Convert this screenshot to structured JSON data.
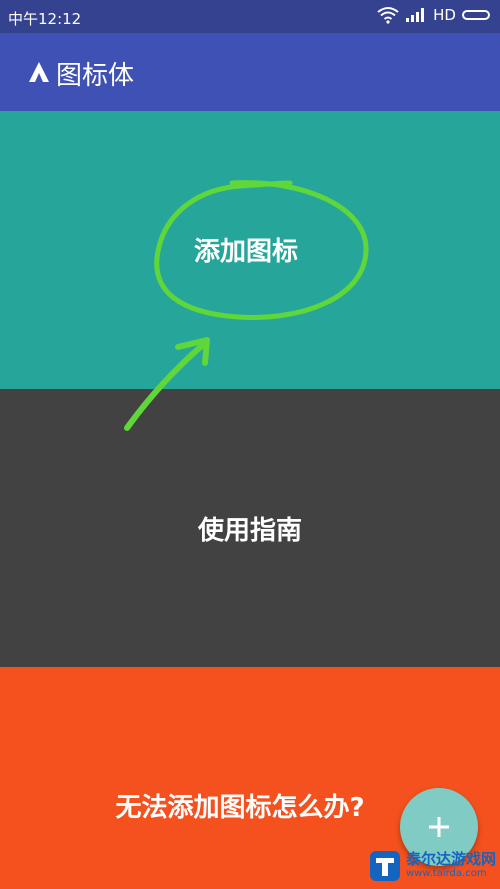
{
  "status_bar": {
    "time": "中午12:12",
    "network": "HD"
  },
  "app_bar": {
    "title": "图标体"
  },
  "panels": {
    "add_icon": "添加图标",
    "guide": "使用指南",
    "help": "无法添加图标怎么办?"
  },
  "fab": {
    "icon": "plus-icon"
  },
  "watermark": {
    "title": "泰尔达游戏网",
    "url": "www.tairda.com"
  },
  "colors": {
    "status_bar": "#35428f",
    "app_bar": "#3f51b5",
    "panel_add": "#26a69a",
    "panel_guide": "#424242",
    "panel_help": "#f4511e",
    "annotation": "#5fd63a"
  }
}
